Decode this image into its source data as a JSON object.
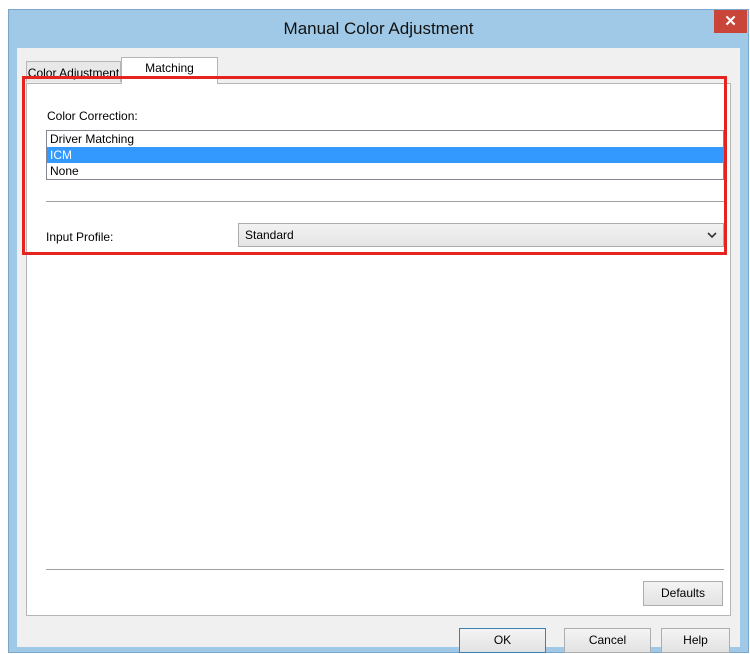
{
  "window": {
    "title": "Manual Color Adjustment",
    "close_glyph": "✕"
  },
  "tabs": [
    {
      "label": "Color Adjustment",
      "active": false
    },
    {
      "label": "Matching",
      "active": true
    }
  ],
  "matching": {
    "color_correction_label": "Color Correction:",
    "color_correction_options": [
      "Driver Matching",
      "ICM",
      "None"
    ],
    "color_correction_selected": "ICM",
    "input_profile_label": "Input Profile:",
    "input_profile_value": "Standard"
  },
  "buttons": {
    "defaults": "Defaults",
    "ok": "OK",
    "cancel": "Cancel",
    "help": "Help"
  },
  "colors": {
    "title_bar": "#9fc9e6",
    "close_button": "#c9453a",
    "selection": "#3399ff",
    "highlight_border": "#e52420"
  },
  "icons": {
    "close": "close-icon",
    "dropdown": "chevron-down-icon"
  }
}
